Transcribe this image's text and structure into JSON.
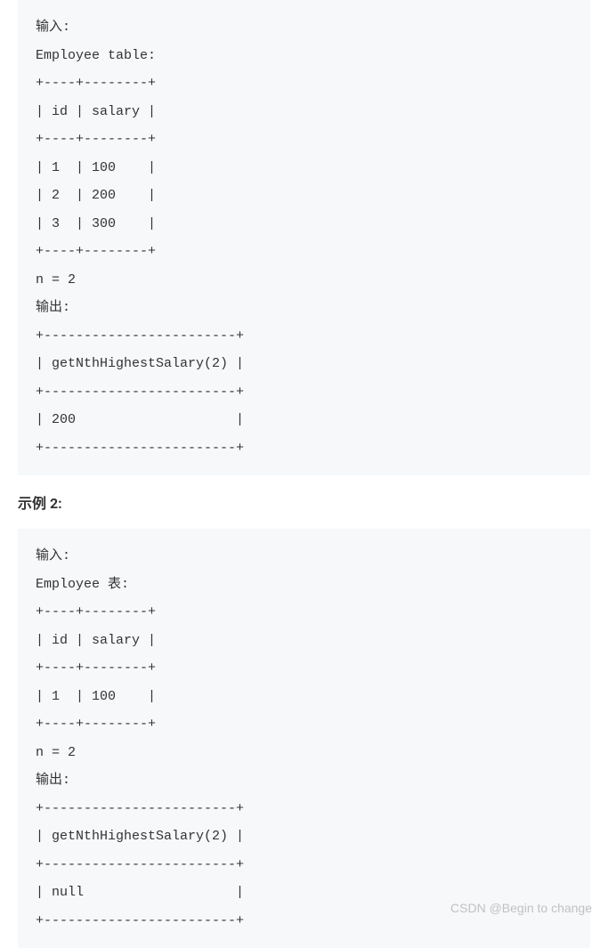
{
  "example1": {
    "code": "输入: \nEmployee table:\n+----+--------+\n| id | salary |\n+----+--------+\n| 1  | 100    |\n| 2  | 200    |\n| 3  | 300    |\n+----+--------+\nn = 2\n输出: \n+------------------------+\n| getNthHighestSalary(2) |\n+------------------------+\n| 200                    |\n+------------------------+"
  },
  "example2_label": "示例 2:",
  "example2": {
    "code": "输入: \nEmployee 表: \n+----+--------+\n| id | salary |\n+----+--------+\n| 1  | 100    |\n+----+--------+\nn = 2\n输出: \n+------------------------+\n| getNthHighestSalary(2) |\n+------------------------+\n| null                   |\n+------------------------+"
  },
  "watermark": "CSDN @Begin to change"
}
